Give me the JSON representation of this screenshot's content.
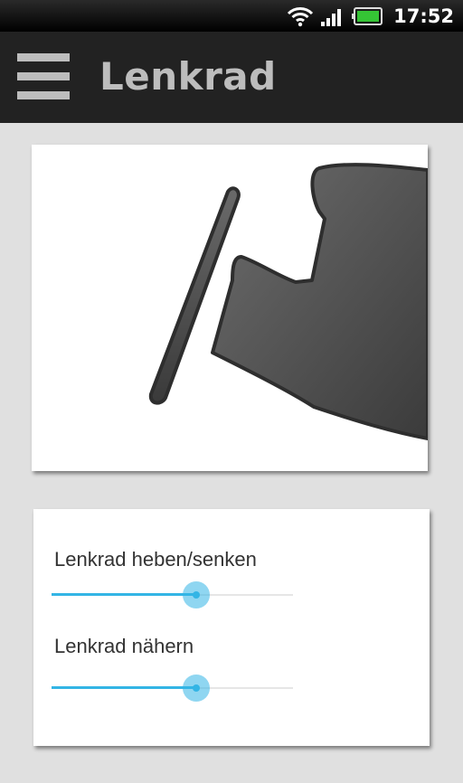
{
  "status_bar": {
    "time": "17:52",
    "icons": [
      "wifi-icon",
      "signal-icon",
      "battery-icon"
    ]
  },
  "action_bar": {
    "title": "Lenkrad",
    "menu_icon": "hamburger-menu-icon"
  },
  "illustration": {
    "icon": "steering-wheel-seat-icon"
  },
  "controls": {
    "sliders": [
      {
        "label": "Lenkrad heben/senken",
        "value": 0.6
      },
      {
        "label": "Lenkrad nähern",
        "value": 0.6
      }
    ]
  },
  "colors": {
    "accent": "#33b5e5",
    "action_bar": "#222222",
    "background": "#e0e0e0",
    "title": "#bdbdbd"
  }
}
